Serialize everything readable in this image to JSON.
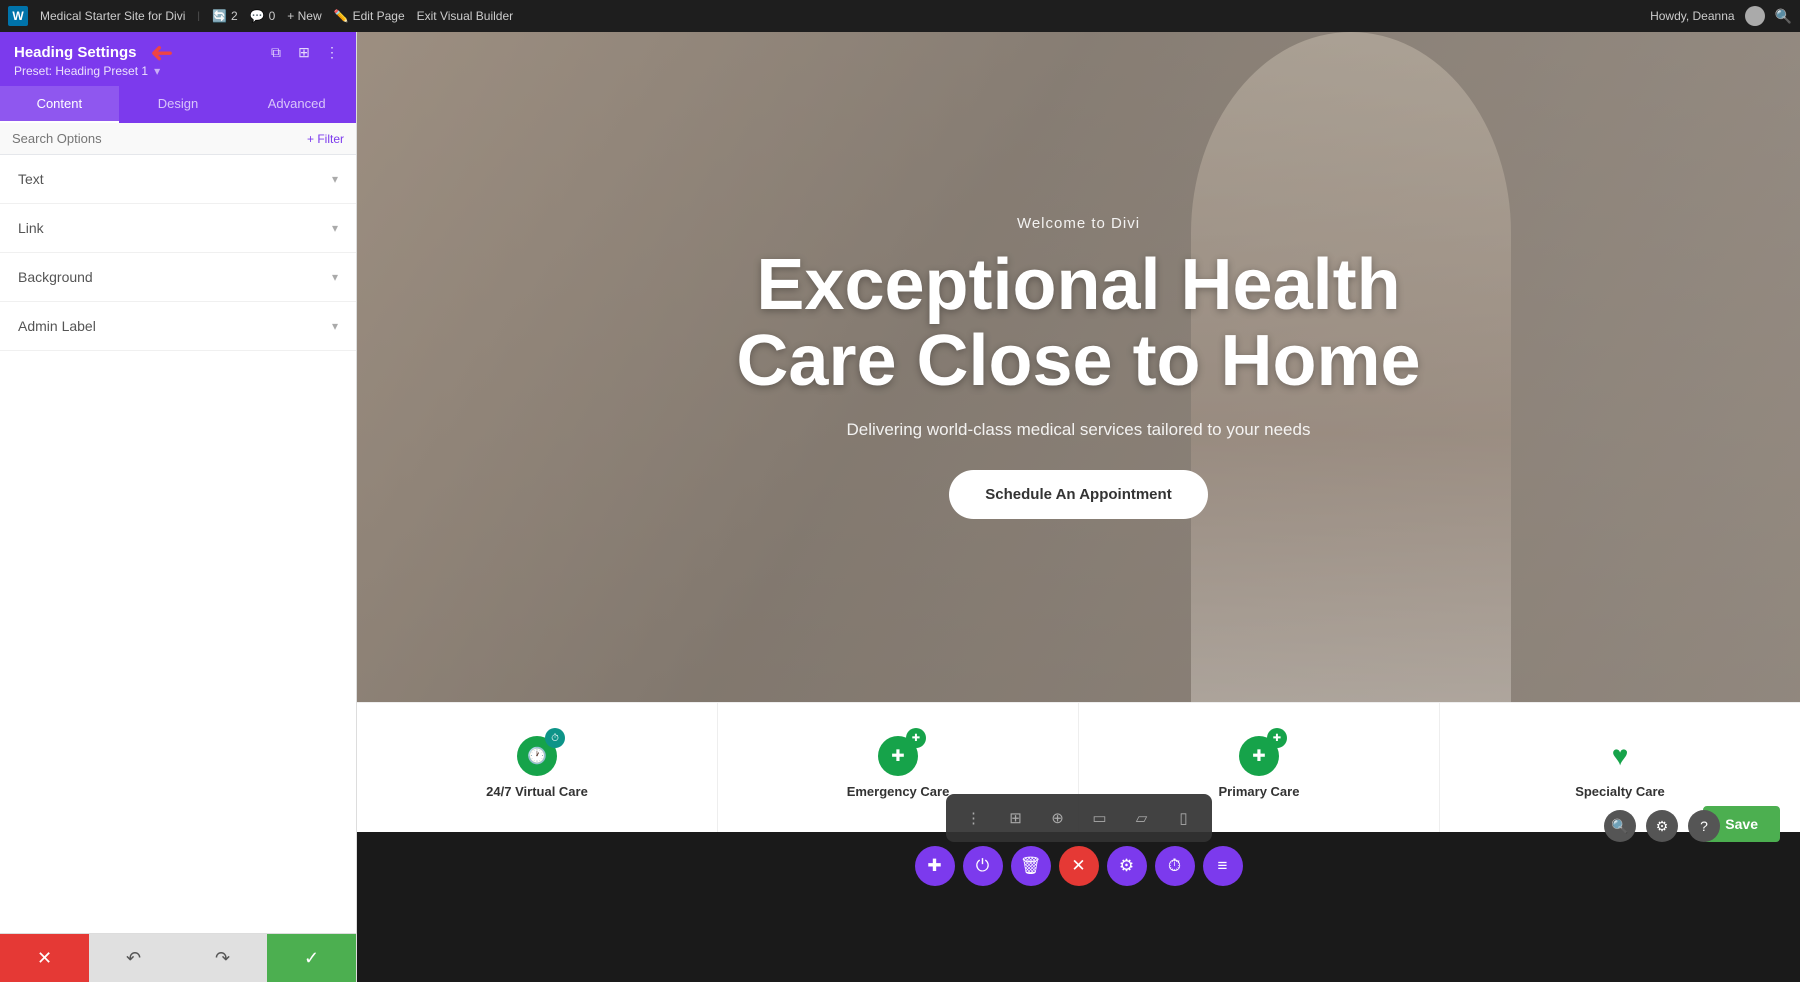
{
  "admin_bar": {
    "wp_icon": "W",
    "site_name": "Medical Starter Site for Divi",
    "update_count": "2",
    "comment_count": "0",
    "new_label": "+ New",
    "edit_page_label": "Edit Page",
    "exit_builder_label": "Exit Visual Builder",
    "howdy_label": "Howdy, Deanna",
    "search_icon": "🔍"
  },
  "left_panel": {
    "title": "Heading Settings",
    "preset_label": "Preset: Heading Preset 1",
    "tabs": [
      {
        "id": "content",
        "label": "Content",
        "active": true
      },
      {
        "id": "design",
        "label": "Design",
        "active": false
      },
      {
        "id": "advanced",
        "label": "Advanced",
        "active": false
      }
    ],
    "search_placeholder": "Search Options",
    "filter_label": "+ Filter",
    "settings_items": [
      {
        "id": "text",
        "label": "Text"
      },
      {
        "id": "link",
        "label": "Link"
      },
      {
        "id": "background",
        "label": "Background"
      },
      {
        "id": "admin_label",
        "label": "Admin Label"
      }
    ],
    "bottom_actions": {
      "cancel_icon": "✕",
      "undo_icon": "↶",
      "redo_icon": "↷",
      "confirm_icon": "✓"
    }
  },
  "hero": {
    "subtitle": "Welcome to Divi",
    "title": "Exceptional Health Care Close to Home",
    "description": "Delivering world-class medical services tailored to your needs",
    "cta_label": "Schedule An Appointment"
  },
  "services": [
    {
      "id": "virtual_care",
      "label": "24/7 Virtual Care",
      "icon": "🕐",
      "icon_type": "teal"
    },
    {
      "id": "emergency_care",
      "label": "Emergency Care",
      "icon": "✚",
      "icon_type": "green"
    },
    {
      "id": "primary_care",
      "label": "Primary Care",
      "icon": "✚",
      "icon_type": "green"
    },
    {
      "id": "specialty_care",
      "label": "Specialty Care",
      "icon": "♥",
      "icon_type": "green-heart"
    }
  ],
  "floating_toolbar": {
    "separator_icon": "⋮",
    "grid_icon": "⊞",
    "search_icon": "⊕",
    "desktop_icon": "▭",
    "tablet_icon": "▱",
    "mobile_icon": "▯"
  },
  "action_buttons": [
    {
      "id": "add",
      "icon": "✚",
      "color": "purple"
    },
    {
      "id": "power",
      "icon": "⏻",
      "color": "purple"
    },
    {
      "id": "trash",
      "icon": "🗑",
      "color": "purple"
    },
    {
      "id": "close",
      "icon": "✕",
      "color": "red-x"
    },
    {
      "id": "gear",
      "icon": "⚙",
      "color": "purple"
    },
    {
      "id": "clock",
      "icon": "⏱",
      "color": "purple"
    },
    {
      "id": "bars",
      "icon": "▤",
      "color": "purple"
    }
  ],
  "save_button_label": "Save",
  "colors": {
    "purple": "#7c3aed",
    "green": "#16a34a",
    "teal": "#0d9488",
    "red": "#e53935"
  }
}
